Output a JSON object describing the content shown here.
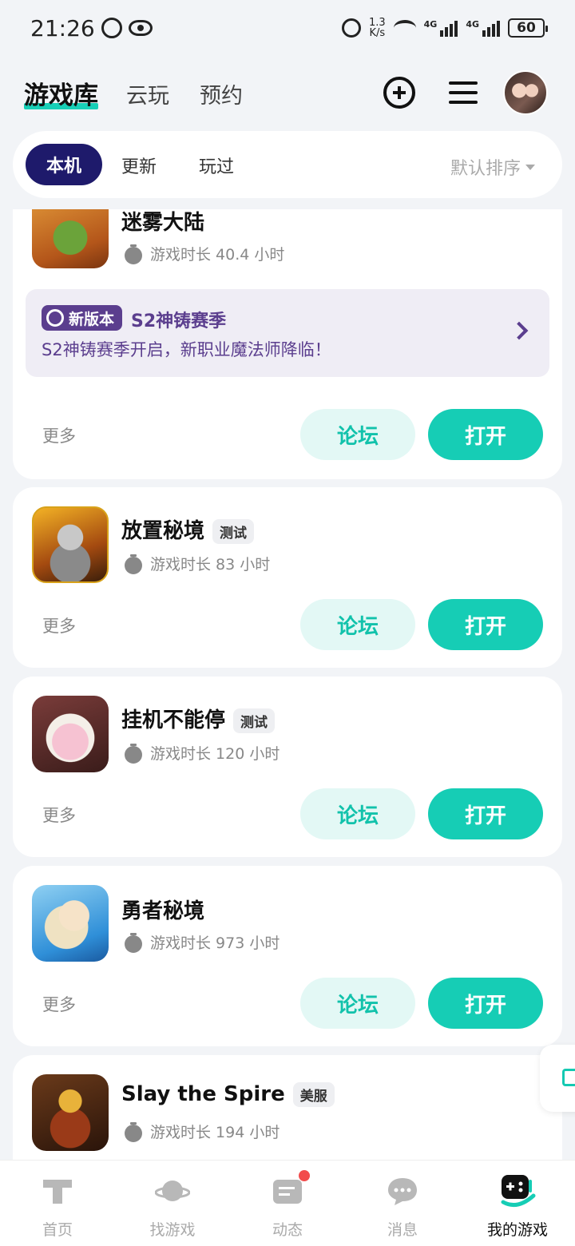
{
  "status_bar": {
    "time": "21:26",
    "net_speed_value": "1.3",
    "net_speed_unit": "K/s",
    "signal_1": "4G",
    "signal_2": "4G",
    "battery": "60"
  },
  "header": {
    "tabs": [
      {
        "label": "游戏库",
        "active": true
      },
      {
        "label": "云玩",
        "active": false
      },
      {
        "label": "预约",
        "active": false
      }
    ]
  },
  "filters": {
    "chips": [
      {
        "label": "本机",
        "active": true
      },
      {
        "label": "更新",
        "active": false
      },
      {
        "label": "玩过",
        "active": false
      }
    ],
    "sort_label": "默认排序"
  },
  "games": [
    {
      "name": "迷雾大陆",
      "tag": "",
      "playtime": "游戏时长 40.4 小时",
      "promo": {
        "badge": "新版本",
        "title": "S2神铸赛季",
        "desc": "S2神铸赛季开启，新职业魔法师降临！"
      },
      "more": "更多",
      "forum": "论坛",
      "open": "打开"
    },
    {
      "name": "放置秘境",
      "tag": "测试",
      "playtime": "游戏时长 83 小时",
      "more": "更多",
      "forum": "论坛",
      "open": "打开"
    },
    {
      "name": "挂机不能停",
      "tag": "测试",
      "playtime": "游戏时长 120 小时",
      "more": "更多",
      "forum": "论坛",
      "open": "打开"
    },
    {
      "name": "勇者秘境",
      "tag": "",
      "playtime": "游戏时长 973 小时",
      "more": "更多",
      "forum": "论坛",
      "open": "打开"
    },
    {
      "name": "Slay the Spire",
      "tag": "美服",
      "playtime": "游戏时长 194 小时"
    }
  ],
  "bottom_nav": [
    {
      "label": "首页",
      "icon": "home-icon",
      "active": false
    },
    {
      "label": "找游戏",
      "icon": "planet-icon",
      "active": false
    },
    {
      "label": "动态",
      "icon": "feed-icon",
      "active": false,
      "badge": true
    },
    {
      "label": "消息",
      "icon": "chat-icon",
      "active": false
    },
    {
      "label": "我的游戏",
      "icon": "gamepad-icon",
      "active": true
    }
  ],
  "colors": {
    "accent": "#16cdb5",
    "forum_bg": "#e3f8f5",
    "chip_active": "#1e1a6b",
    "promo": "#5b3e8e"
  }
}
